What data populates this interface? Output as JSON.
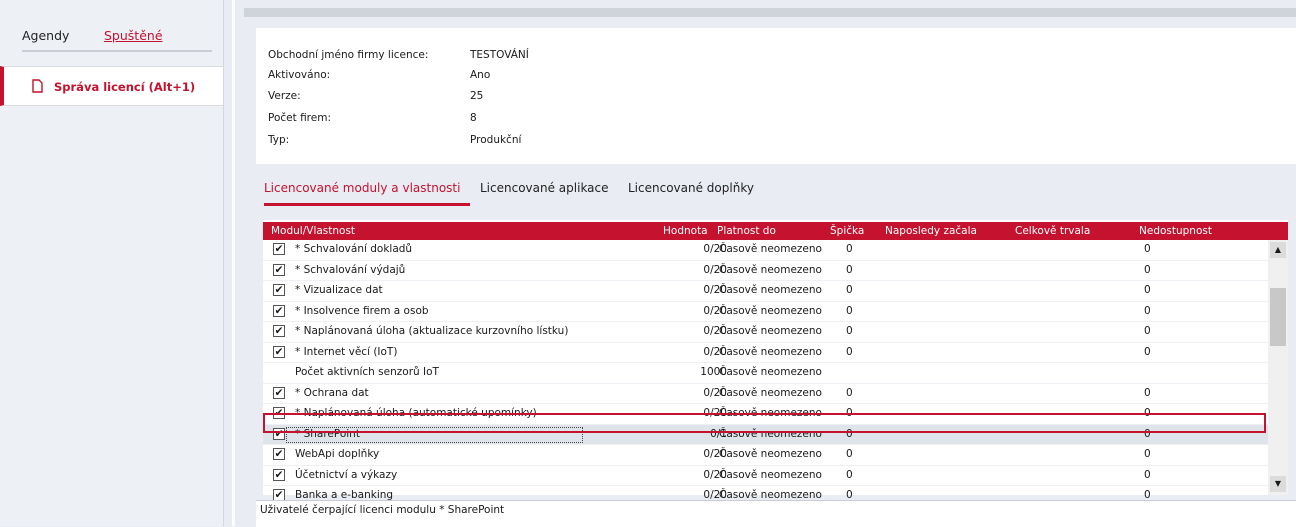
{
  "sidebar": {
    "tabs": [
      {
        "label": "Agendy"
      },
      {
        "label": "Spuštěné"
      }
    ],
    "item": {
      "label": "Správa licencí (Alt+1)",
      "icon": "document-icon"
    }
  },
  "info": {
    "rows": [
      {
        "key": "Obchodní jméno firmy licence:",
        "value": "TESTOVÁNÍ"
      },
      {
        "key": "Aktivováno:",
        "value": "Ano"
      },
      {
        "key": "Verze:",
        "value": "25"
      },
      {
        "key": "Počet firem:",
        "value": "8"
      },
      {
        "key": "Typ:",
        "value": "Produkční"
      }
    ]
  },
  "tabs": [
    {
      "label": "Licencované moduly a vlastnosti"
    },
    {
      "label": "Licencované aplikace"
    },
    {
      "label": "Licencované doplňky"
    }
  ],
  "grid": {
    "headers": {
      "modul": "Modul/Vlastnost",
      "hodnota": "Hodnota",
      "platnost": "Platnost do",
      "spicka": "Špička",
      "naposledy": "Naposledy začala",
      "celkove": "Celkově trvala",
      "nedostupnost": "Nedostupnost"
    },
    "rows": [
      {
        "checked": true,
        "name": "* Schvalování dokladů",
        "value": "0/20",
        "platnost": "Časově neomezeno",
        "spicka": "0",
        "ned": "0"
      },
      {
        "checked": true,
        "name": "* Schvalování výdajů",
        "value": "0/20",
        "platnost": "Časově neomezeno",
        "spicka": "0",
        "ned": "0"
      },
      {
        "checked": true,
        "name": "* Vizualizace dat",
        "value": "0/20",
        "platnost": "Časově neomezeno",
        "spicka": "0",
        "ned": "0"
      },
      {
        "checked": true,
        "name": "* Insolvence firem a osob",
        "value": "0/20",
        "platnost": "Časově neomezeno",
        "spicka": "0",
        "ned": "0"
      },
      {
        "checked": true,
        "name": "* Naplánovaná úloha (aktualizace kurzovního lístku)",
        "value": "0/20",
        "platnost": "Časově neomezeno",
        "spicka": "0",
        "ned": "0"
      },
      {
        "checked": true,
        "name": "* Internet věcí (IoT)",
        "value": "0/20",
        "platnost": "Časově neomezeno",
        "spicka": "0",
        "ned": "0"
      },
      {
        "checked": false,
        "name": "Počet aktivních senzorů IoT",
        "value": "1000",
        "platnost": "Časově neomezeno",
        "spicka": "",
        "ned": ""
      },
      {
        "checked": true,
        "name": "* Ochrana dat",
        "value": "0/20",
        "platnost": "Časově neomezeno",
        "spicka": "0",
        "ned": "0"
      },
      {
        "checked": true,
        "name": "* Naplánovaná úloha (automatické upomínky)",
        "value": "0/20",
        "platnost": "Časově neomezeno",
        "spicka": "0",
        "ned": "0"
      },
      {
        "checked": true,
        "name": "* SharePoint",
        "value": "0/1",
        "platnost": "Časově neomezeno",
        "spicka": "0",
        "ned": "0",
        "selected": true
      },
      {
        "checked": true,
        "name": "WebApi doplňky",
        "value": "0/20",
        "platnost": "Časově neomezeno",
        "spicka": "0",
        "ned": "0"
      },
      {
        "checked": true,
        "name": "Účetnictví a výkazy",
        "value": "0/20",
        "platnost": "Časově neomezeno",
        "spicka": "0",
        "ned": "0"
      },
      {
        "checked": true,
        "name": "Banka a e-banking",
        "value": "0/20",
        "platnost": "Časově neomezeno",
        "spicka": "0",
        "ned": "0"
      }
    ]
  },
  "footer": {
    "label": "Uživatelé čerpající licenci modulu  * SharePoint"
  },
  "colors": {
    "accent": "#c4122f"
  }
}
